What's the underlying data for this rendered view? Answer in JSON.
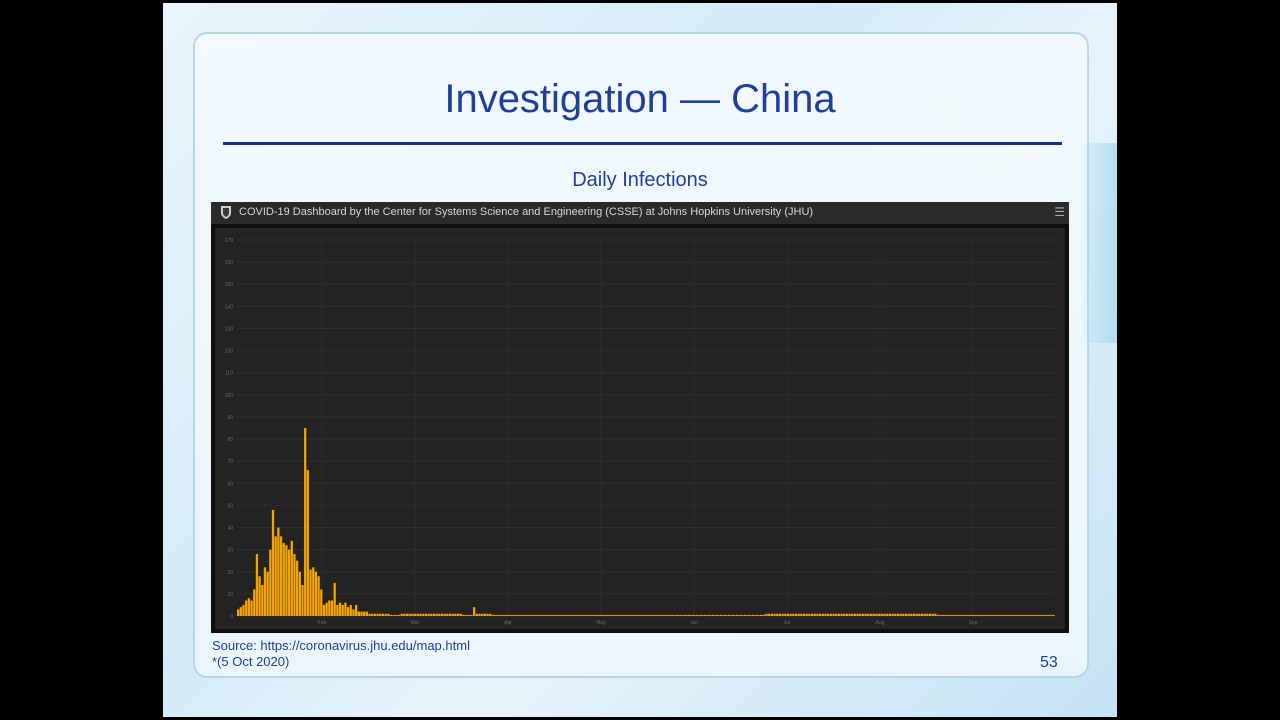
{
  "slide": {
    "title": "Investigation — China",
    "subtitle": "Daily Infections",
    "dashboard_title": "COVID-19 Dashboard by the Center for Systems Science and Engineering (CSSE) at Johns Hopkins University (JHU)",
    "source_line": "Source: https://coronavirus.jhu.edu/map.html",
    "date_line": "*(5 Oct 2020)",
    "page_number": "53",
    "menu_icon": "hamburger-icon",
    "shield_icon": "jhu-shield-icon"
  },
  "colors": {
    "title": "#1f3f9a",
    "bar": "#f5a300",
    "panel": "#232323"
  },
  "chart_data": {
    "type": "bar",
    "series": [
      {
        "values": [
          3,
          4,
          5,
          7,
          8,
          7,
          12,
          28,
          18,
          14,
          22,
          20,
          30,
          48,
          36,
          40,
          36,
          33,
          32,
          30,
          34,
          28,
          25,
          20,
          14,
          85,
          66,
          21,
          22,
          20,
          18,
          12,
          5,
          6,
          7,
          7,
          15,
          5,
          6,
          5,
          6,
          4,
          5,
          3,
          5,
          2,
          2,
          2,
          2,
          1,
          1,
          1,
          1,
          1,
          1,
          1,
          1,
          0.5,
          0.5,
          0.5,
          0.5,
          1,
          1,
          1,
          1,
          1,
          1,
          1,
          1,
          1,
          1,
          1,
          1,
          1,
          1,
          1,
          1,
          1,
          1,
          1,
          1,
          1,
          1,
          1,
          0.5,
          0.5,
          0.5,
          0.5,
          4,
          1,
          1,
          1,
          1,
          1,
          1,
          0.5,
          0.5,
          0.5,
          0.5,
          0.5,
          0.5,
          0.5,
          0.5,
          0.5,
          0.5,
          0.5,
          0.5,
          0.5,
          0.5,
          0.5,
          0.5,
          0.5,
          0.5,
          0.5,
          0.5,
          0.5,
          0.5,
          0.5,
          0.5,
          0.5,
          0.5,
          0.5,
          0.5,
          0.5,
          0.5,
          0.5,
          0.5,
          0.5,
          0.5,
          0.5,
          0.5,
          0.5,
          0.5,
          0.5,
          0.5,
          0.5,
          0.5,
          0.5,
          0.5,
          0.5,
          0.5,
          0.5,
          0.5,
          0.5,
          0.5,
          0.5,
          0.5,
          0.5,
          0.5,
          0.5,
          0.5,
          0.5,
          0.5,
          0.5,
          0.5,
          0.5,
          0.5,
          0.5,
          0.5,
          0.5,
          0.5,
          0.5,
          0.5,
          0.5,
          0.5,
          0.5,
          0.5,
          0.5,
          0.5,
          0.5,
          0.5,
          0.5,
          0.5,
          0.5,
          0.5,
          0.5,
          0.5,
          0.5,
          0.5,
          0.5,
          0.5,
          0.5,
          0.5,
          0.5,
          0.5,
          0.5,
          0.5,
          0.5,
          0.5,
          0.5,
          0.5,
          0.5,
          0.5,
          0.5,
          0.5,
          0.5,
          0.5,
          1,
          1,
          1,
          1,
          1,
          1,
          1,
          1,
          1,
          1,
          1,
          1,
          1,
          1,
          1,
          1,
          1,
          1,
          1,
          1,
          1,
          1,
          1,
          1,
          1,
          1,
          1,
          1,
          1,
          1,
          1,
          1,
          1,
          1,
          1,
          1,
          1,
          1,
          1,
          1,
          1,
          1,
          1,
          1,
          1,
          1,
          1,
          1,
          1,
          1,
          1,
          1,
          1,
          1,
          1,
          1,
          1,
          1,
          1,
          1,
          1,
          1,
          1,
          1,
          0.5,
          0.5,
          0.5,
          0.5,
          0.5,
          0.5,
          0.5,
          0.5,
          0.5,
          0.5,
          0.5,
          0.5,
          0.5,
          0.5,
          0.5,
          0.5,
          0.5,
          0.5,
          0.5,
          0.5,
          0.5,
          0.5,
          0.5,
          0.5,
          0.5,
          0.5,
          0.5,
          0.5,
          0.5,
          0.5,
          0.5,
          0.5,
          0.5,
          0.5,
          0.5,
          0.5,
          0.5,
          0.5,
          0.5,
          0.5,
          0.5,
          0.5,
          0.5,
          0.5
        ]
      }
    ],
    "ylim": [
      0,
      170
    ],
    "yticks": [
      "0",
      "10",
      "20",
      "30",
      "40",
      "50",
      "60",
      "70",
      "80",
      "90",
      "100",
      "110",
      "120",
      "130",
      "140",
      "150",
      "160",
      "170"
    ],
    "xticks": [
      "Feb",
      "Mar",
      "Apr",
      "May",
      "Jun",
      "Jul",
      "Aug",
      "Sep"
    ],
    "grid": true
  }
}
